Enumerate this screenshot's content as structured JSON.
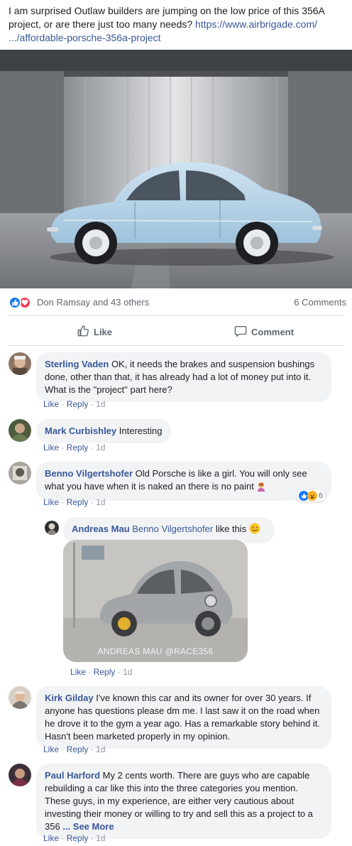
{
  "post": {
    "text": "I am surprised Outlaw builders are jumping on the low price of this 356A project, or are there just too many needs?",
    "link_line1": "https://www.airbrigade.com/",
    "link_line2": ".../affordable-porsche-356a-project"
  },
  "reactions": {
    "reactors": "Don Ramsay and 43 others",
    "comments_count": "6 Comments"
  },
  "actions": {
    "like_label": "Like",
    "comment_label": "Comment"
  },
  "meta_labels": {
    "like": "Like",
    "reply": "Reply",
    "dot": "·"
  },
  "comments": [
    {
      "author": "Sterling Vaden",
      "text": "OK, it needs the brakes and suspension bushings done, other than that, it has already had a lot of money put into it. What is the \"project\" part here?",
      "time": "1d"
    },
    {
      "author": "Mark Curbishley",
      "text": "Interesting",
      "time": "1d"
    },
    {
      "author": "Benno Vilgertshofer",
      "text": "Old Porsche is like a girl. You will only see what you have when it is naked an there is no paint",
      "time": "1d",
      "reaction_count": "6"
    },
    {
      "author": "Andreas Mau",
      "mention": "Benno Vilgertshofer",
      "text": "like this",
      "time": "1d",
      "watermark": "ANDREAS MAU @RACE356"
    },
    {
      "author": "Kirk Gilday",
      "text": "I've known this car and its owner for over 30 years. If anyone has questions please dm me. I last saw it on the road when he drove it to the gym a year ago. Has a remarkable story behind it. Hasn't been marketed properly in my opinion.",
      "time": "1d"
    },
    {
      "author": "Paul Harford",
      "text": "My 2 cents worth. There are guys who are capable rebuilding a car like this into the three categories you mention. These guys, in my experience, are either very cautious about investing their money or willing to try and sell this as a project to a 356",
      "see_more": "... See More",
      "time": "1d"
    }
  ],
  "colors": {
    "link": "#385898",
    "bubble": "#f2f3f5",
    "meta_gray": "#90949c",
    "like_blue": "#1877f2",
    "love_red": "#f33e58",
    "car_blue": "#b9d6ea"
  },
  "icons": {
    "like": "thumbs-up-icon",
    "comment": "speech-bubble-icon",
    "love": "heart-icon",
    "haha": "laughing-face-icon",
    "smile": "smiling-face-emoji",
    "woman": "woman-shrugging-emoji"
  }
}
